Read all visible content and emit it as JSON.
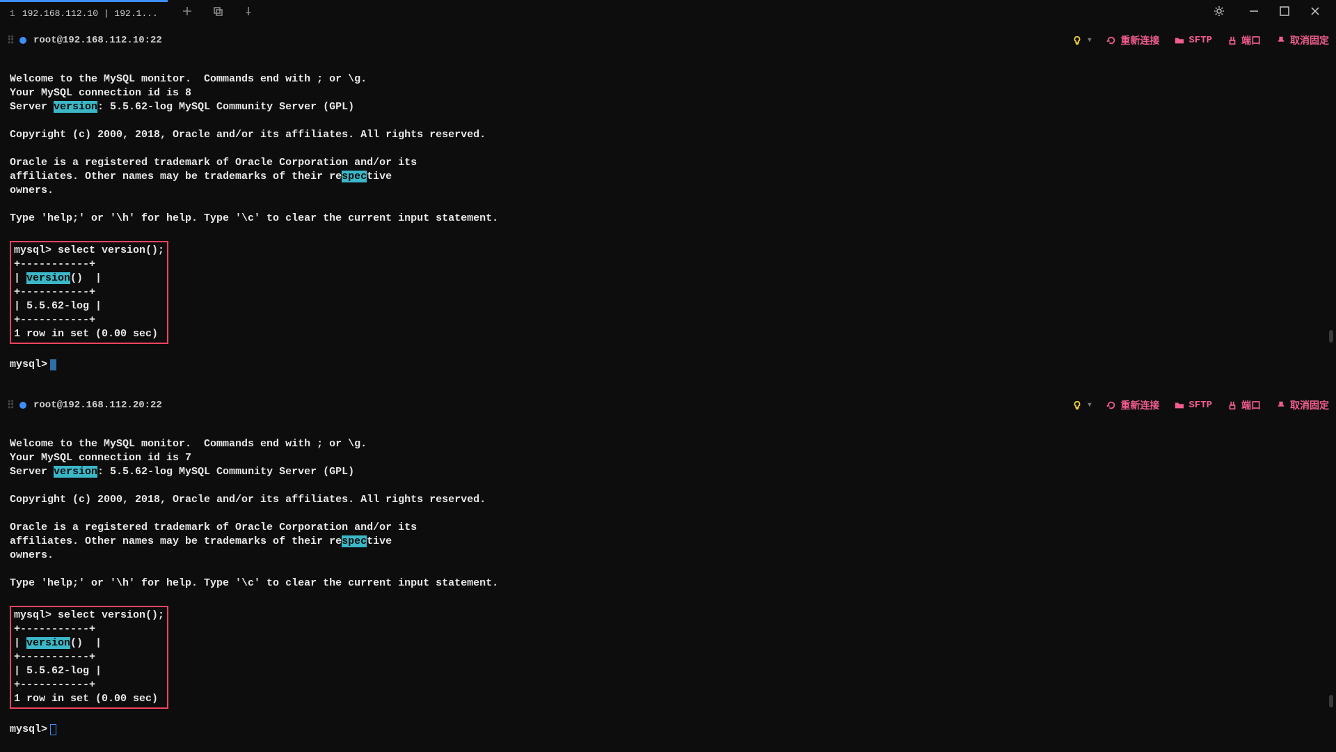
{
  "titlebar": {
    "tab_index": "1",
    "tab_title": "192.168.112.10 | 192.1..."
  },
  "actions": {
    "reconnect": "重新连接",
    "sftp": "SFTP",
    "port": "端口",
    "unpin": "取消固定"
  },
  "pane1": {
    "host": "root@192.168.112.10:22",
    "welcome1": "Welcome to the MySQL monitor.  Commands end with ; or \\g.",
    "conn_id": "Your MySQL connection id is 8",
    "srv_pre": "Server ",
    "srv_hl": "version",
    "srv_post": ": 5.5.62-log MySQL Community Server (GPL)",
    "copyright": "Copyright (c) 2000, 2018, Oracle and/or its affiliates. All rights reserved.",
    "trade1": "Oracle is a registered trademark of Oracle Corporation and/or its",
    "trade2a": "affiliates. Other names may be trademarks of their re",
    "trade2hl": "spec",
    "trade2b": "tive",
    "trade3": "owners.",
    "help": "Type 'help;' or '\\h' for help. Type '\\c' to clear the current input statement.",
    "q_line": "mysql> select version();",
    "sep": "+-----------+",
    "hdr_a": "| ",
    "hdr_hl": "version",
    "hdr_b": "()  |",
    "row": "| 5.5.62-log |",
    "rows": "1 row in set (0.00 sec)",
    "prompt": "mysql>"
  },
  "pane2": {
    "host": "root@192.168.112.20:22",
    "welcome1": "Welcome to the MySQL monitor.  Commands end with ; or \\g.",
    "conn_id": "Your MySQL connection id is 7",
    "srv_pre": "Server ",
    "srv_hl": "version",
    "srv_post": ": 5.5.62-log MySQL Community Server (GPL)",
    "copyright": "Copyright (c) 2000, 2018, Oracle and/or its affiliates. All rights reserved.",
    "trade1": "Oracle is a registered trademark of Oracle Corporation and/or its",
    "trade2a": "affiliates. Other names may be trademarks of their re",
    "trade2hl": "spec",
    "trade2b": "tive",
    "trade3": "owners.",
    "help": "Type 'help;' or '\\h' for help. Type '\\c' to clear the current input statement.",
    "q_line": "mysql> select version();",
    "sep": "+-----------+",
    "hdr_a": "| ",
    "hdr_hl": "version",
    "hdr_b": "()  |",
    "row": "| 5.5.62-log |",
    "rows": "1 row in set (0.00 sec)",
    "prompt": "mysql>"
  }
}
